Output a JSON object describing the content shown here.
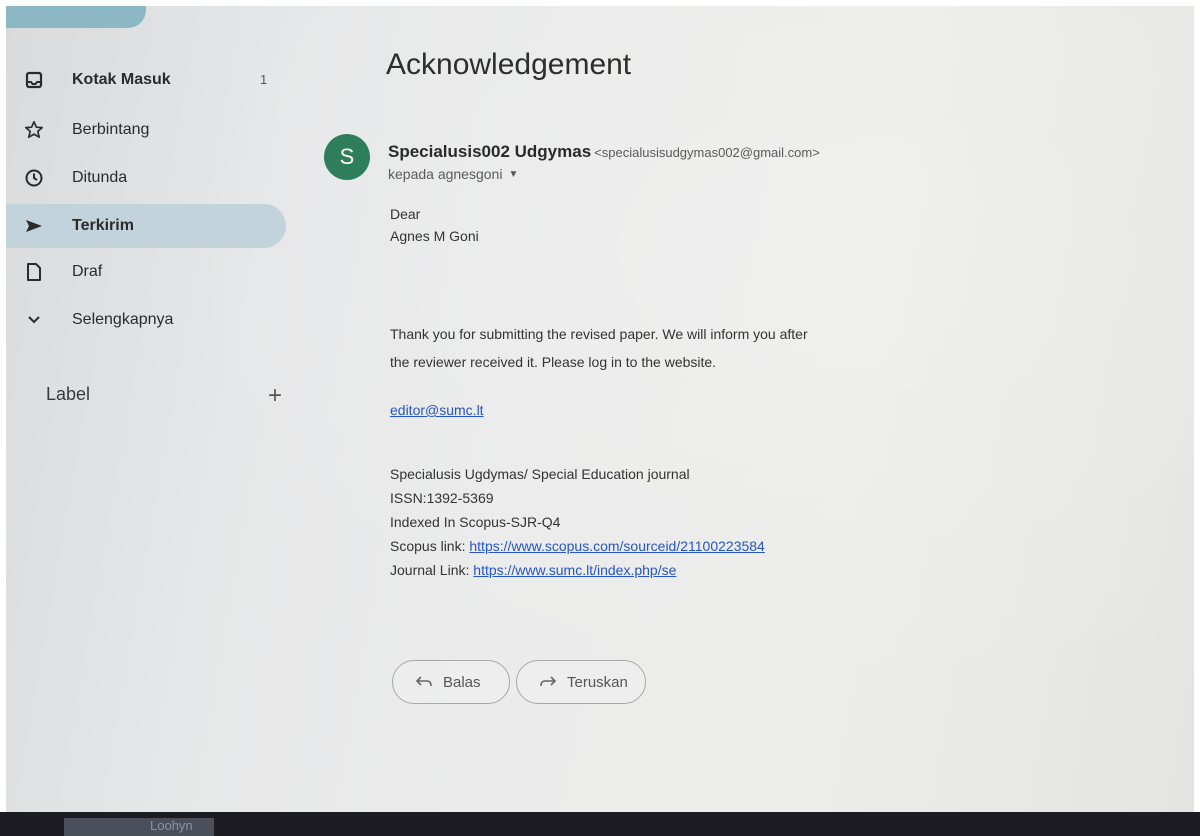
{
  "sidebar": {
    "items": [
      {
        "label": "Kotak Masuk",
        "icon": "inbox-icon",
        "count": "1"
      },
      {
        "label": "Berbintang",
        "icon": "star-icon"
      },
      {
        "label": "Ditunda",
        "icon": "clock-icon"
      },
      {
        "label": "Terkirim",
        "icon": "send-icon",
        "active": true
      },
      {
        "label": "Draf",
        "icon": "draft-icon"
      },
      {
        "label": "Selengkapnya",
        "icon": "chevron-down-icon"
      }
    ],
    "label_heading": "Label",
    "label_add": "+"
  },
  "mail": {
    "subject": "Acknowledgement",
    "avatar_letter": "S",
    "sender_name": "Specialusis002 Udgymas",
    "sender_email": "<specialusisudgymas002@gmail.com>",
    "recipient": "kepada agnesgoni",
    "body": {
      "greeting": "Dear",
      "name": "Agnes M Goni",
      "line1": "Thank you for submitting the revised paper.  We will inform you after",
      "line2": "the reviewer received it. Please log in to the website.",
      "email_link": "editor@sumc.lt",
      "sig1": "Specialusis Ugdymas/ Special Education journal",
      "sig2": "ISSN:1392-5369",
      "sig3": "Indexed In Scopus-SJR-Q4",
      "scopus_label": " Scopus link: ",
      "scopus_url": "https://www.scopus.com/sourceid/21100223584",
      "journal_label": "Journal Link: ",
      "journal_url": "https://www.sumc.lt/index.php/se"
    }
  },
  "actions": {
    "reply": "Balas",
    "forward": "Teruskan"
  },
  "taskbar": {
    "text": "Loohyn"
  },
  "colors": {
    "avatar": "#2f7e5b",
    "active_nav": "#c3d3dc",
    "link": "#2555c8"
  }
}
